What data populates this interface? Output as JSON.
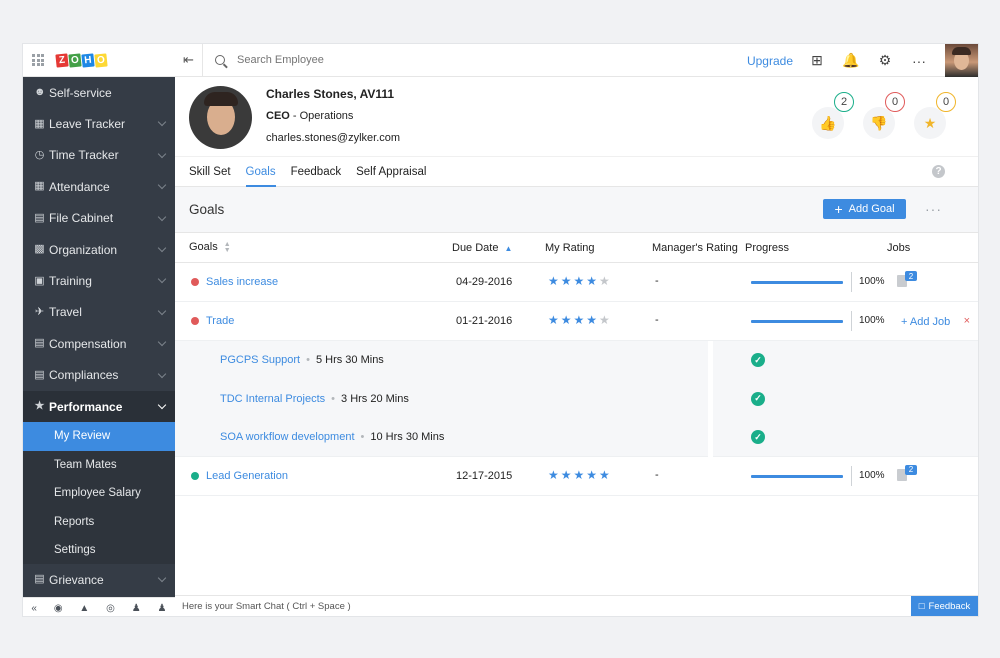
{
  "brand": {
    "letters": [
      "Z",
      "O",
      "H",
      "O"
    ],
    "colors": [
      "#e53935",
      "#43a047",
      "#1e88e5",
      "#fdd835"
    ]
  },
  "sidebar": {
    "items": [
      {
        "label": "Self-service",
        "icon": "user-icon",
        "chevron": false
      },
      {
        "label": "Leave Tracker",
        "icon": "calendar-icon",
        "chevron": true
      },
      {
        "label": "Time Tracker",
        "icon": "clock-icon",
        "chevron": true
      },
      {
        "label": "Attendance",
        "icon": "attendance-icon",
        "chevron": true
      },
      {
        "label": "File Cabinet",
        "icon": "file-icon",
        "chevron": true
      },
      {
        "label": "Organization",
        "icon": "building-icon",
        "chevron": true
      },
      {
        "label": "Training",
        "icon": "training-icon",
        "chevron": true
      },
      {
        "label": "Travel",
        "icon": "plane-icon",
        "chevron": true
      },
      {
        "label": "Compensation",
        "icon": "money-icon",
        "chevron": true
      },
      {
        "label": "Compliances",
        "icon": "compliance-icon",
        "chevron": true
      }
    ],
    "performance": {
      "label": "Performance",
      "sub": [
        "My Review",
        "Team Mates",
        "Employee Salary",
        "Reports",
        "Settings"
      ],
      "active_index": 0
    },
    "after": [
      {
        "label": "Grievance",
        "icon": "grievance-icon"
      }
    ]
  },
  "topbar": {
    "search_placeholder": "Search Employee",
    "upgrade": "Upgrade"
  },
  "profile": {
    "name": "Charles Stones, AV111",
    "role_title": "CEO",
    "role_dept": " - Operations",
    "email": "charles.stones@zylker.com",
    "badges": [
      {
        "count": "2",
        "icon": "thumbs-up-icon",
        "color": "#1aae8a"
      },
      {
        "count": "0",
        "icon": "thumbs-down-icon",
        "color": "#e05a5a"
      },
      {
        "count": "0",
        "icon": "award-icon",
        "color": "#f0b52b"
      }
    ]
  },
  "tabs": [
    "Skill Set",
    "Goals",
    "Feedback",
    "Self Appraisal"
  ],
  "active_tab": 1,
  "goals_section": {
    "title": "Goals",
    "add_goal": "Add Goal"
  },
  "table": {
    "headers": {
      "goals": "Goals",
      "due": "Due Date",
      "my_rating": "My Rating",
      "mgr_rating": "Manager's Rating",
      "progress": "Progress",
      "jobs": "Jobs"
    },
    "rows": [
      {
        "goal": "Sales increase",
        "dot": "#e05a5a",
        "due": "04-29-2016",
        "rating": 4,
        "mgr": "-",
        "progress": 100,
        "progress_label": "100%",
        "jobs": "2"
      },
      {
        "goal": "Trade",
        "dot": "#e05a5a",
        "due": "01-21-2016",
        "rating": 4,
        "mgr": "-",
        "progress": 100,
        "progress_label": "100%",
        "add_job": "+ Add Job",
        "remove": "×",
        "jobs_list": [
          {
            "name": "PGCPS Support",
            "duration": "5 Hrs 30 Mins"
          },
          {
            "name": "TDC Internal Projects",
            "duration": "3 Hrs 20 Mins"
          },
          {
            "name": "SOA workflow development",
            "duration": "10 Hrs 30 Mins"
          }
        ]
      },
      {
        "goal": "Lead Generation",
        "dot": "#1aae8a",
        "due": "12-17-2015",
        "rating": 5,
        "mgr": "-",
        "progress": 100,
        "progress_label": "100%",
        "jobs": "2"
      }
    ]
  },
  "chat": {
    "placeholder": "Here is your Smart Chat ( Ctrl + Space )",
    "feedback": "Feedback"
  }
}
